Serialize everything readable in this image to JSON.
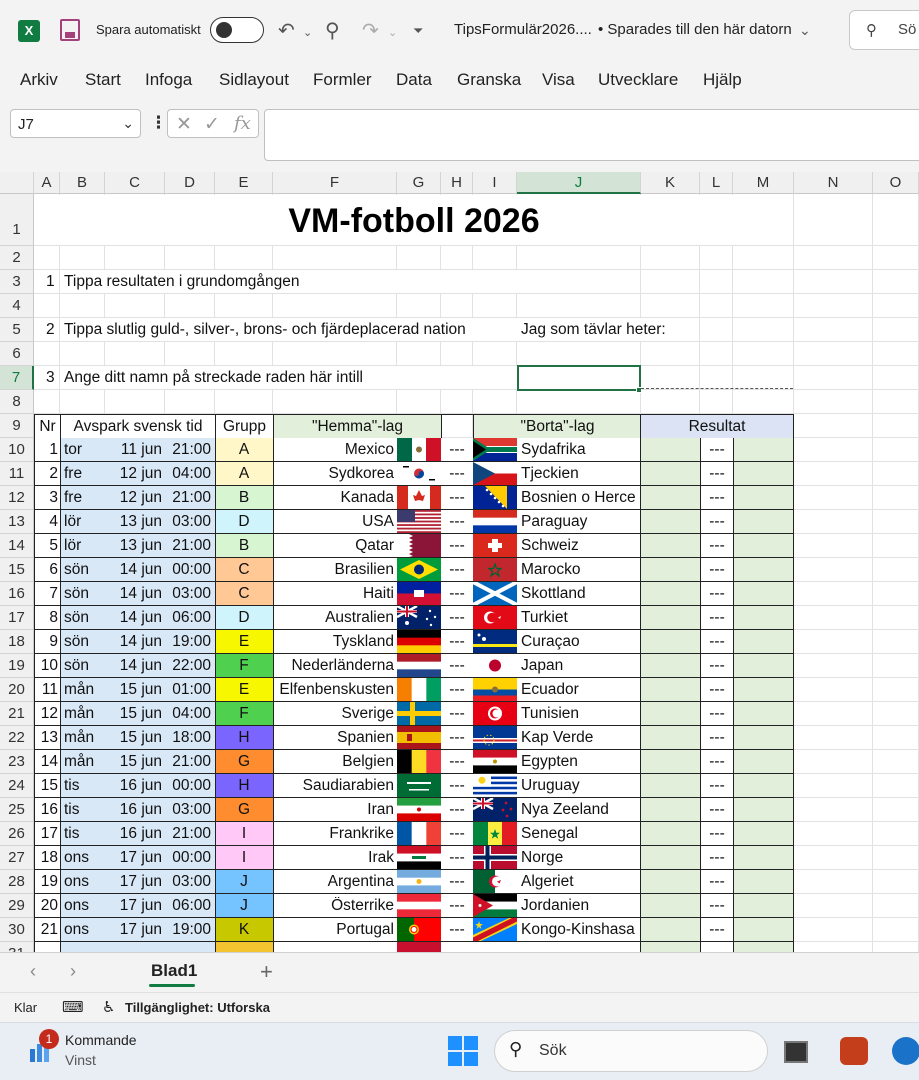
{
  "titlebar": {
    "app_icon_letter": "X",
    "autosave_label": "Spara automatiskt",
    "doc_title": "TipsFormulär2026....",
    "saved_status": "• Sparades till den här datorn",
    "search_placeholder": "Sö"
  },
  "ribbon": {
    "tabs": [
      "Arkiv",
      "Start",
      "Infoga",
      "Sidlayout",
      "Formler",
      "Data",
      "Granska",
      "Visa",
      "Utvecklare",
      "Hjälp"
    ]
  },
  "formula_bar": {
    "name_box": "J7",
    "fx": "fx",
    "value": ""
  },
  "columns": [
    "A",
    "B",
    "C",
    "D",
    "E",
    "F",
    "G",
    "H",
    "I",
    "J",
    "K",
    "L",
    "M",
    "N",
    "O"
  ],
  "selected_cell": "J7",
  "rows": [
    "1",
    "2",
    "3",
    "4",
    "5",
    "6",
    "7",
    "8",
    "9",
    "10",
    "11",
    "12",
    "13",
    "14",
    "15",
    "16",
    "17",
    "18",
    "19",
    "20",
    "21",
    "22",
    "23",
    "24",
    "25",
    "26",
    "27",
    "28",
    "29",
    "30",
    "31"
  ],
  "sheet": {
    "title": "VM-fotboll 2026",
    "instructions": [
      {
        "num": "1",
        "text": "Tippa resultaten i grundomgången"
      },
      {
        "num": "2",
        "text": "Tippa slutlig guld-, silver-, brons- och fjärdeplacerad nation"
      },
      {
        "num": "3",
        "text": "Ange ditt namn på streckade raden här intill"
      }
    ],
    "name_prompt": "Jag som tävlar heter:",
    "headers": {
      "nr": "Nr",
      "kickoff": "Avspark svensk tid",
      "group": "Grupp",
      "home": "\"Hemma\"-lag",
      "away": "\"Borta\"-lag",
      "result": "Resultat"
    },
    "separator": "---",
    "matches": [
      {
        "nr": "1",
        "day": "tor",
        "date": "11 jun",
        "time": "21:00",
        "group": "A",
        "home": "Mexico",
        "away": "Sydafrika"
      },
      {
        "nr": "2",
        "day": "fre",
        "date": "12 jun",
        "time": "04:00",
        "group": "A",
        "home": "Sydkorea",
        "away": "Tjeckien"
      },
      {
        "nr": "3",
        "day": "fre",
        "date": "12 jun",
        "time": "21:00",
        "group": "B",
        "home": "Kanada",
        "away": "Bosnien o Herce"
      },
      {
        "nr": "4",
        "day": "lör",
        "date": "13 jun",
        "time": "03:00",
        "group": "D",
        "home": "USA",
        "away": "Paraguay"
      },
      {
        "nr": "5",
        "day": "lör",
        "date": "13 jun",
        "time": "21:00",
        "group": "B",
        "home": "Qatar",
        "away": "Schweiz"
      },
      {
        "nr": "6",
        "day": "sön",
        "date": "14 jun",
        "time": "00:00",
        "group": "C",
        "home": "Brasilien",
        "away": "Marocko"
      },
      {
        "nr": "7",
        "day": "sön",
        "date": "14 jun",
        "time": "03:00",
        "group": "C",
        "home": "Haiti",
        "away": "Skottland"
      },
      {
        "nr": "8",
        "day": "sön",
        "date": "14 jun",
        "time": "06:00",
        "group": "D",
        "home": "Australien",
        "away": "Turkiet"
      },
      {
        "nr": "9",
        "day": "sön",
        "date": "14 jun",
        "time": "19:00",
        "group": "E",
        "home": "Tyskland",
        "away": "Curaçao"
      },
      {
        "nr": "10",
        "day": "sön",
        "date": "14 jun",
        "time": "22:00",
        "group": "F",
        "home": "Nederländerna",
        "away": "Japan"
      },
      {
        "nr": "11",
        "day": "mån",
        "date": "15 jun",
        "time": "01:00",
        "group": "E",
        "home": "Elfenbenskusten",
        "away": "Ecuador"
      },
      {
        "nr": "12",
        "day": "mån",
        "date": "15 jun",
        "time": "04:00",
        "group": "F",
        "home": "Sverige",
        "away": "Tunisien"
      },
      {
        "nr": "13",
        "day": "mån",
        "date": "15 jun",
        "time": "18:00",
        "group": "H",
        "home": "Spanien",
        "away": "Kap Verde"
      },
      {
        "nr": "14",
        "day": "mån",
        "date": "15 jun",
        "time": "21:00",
        "group": "G",
        "home": "Belgien",
        "away": "Egypten"
      },
      {
        "nr": "15",
        "day": "tis",
        "date": "16 jun",
        "time": "00:00",
        "group": "H",
        "home": "Saudiarabien",
        "away": "Uruguay"
      },
      {
        "nr": "16",
        "day": "tis",
        "date": "16 jun",
        "time": "03:00",
        "group": "G",
        "home": "Iran",
        "away": "Nya Zeeland"
      },
      {
        "nr": "17",
        "day": "tis",
        "date": "16 jun",
        "time": "21:00",
        "group": "I",
        "home": "Frankrike",
        "away": "Senegal"
      },
      {
        "nr": "18",
        "day": "ons",
        "date": "17 jun",
        "time": "00:00",
        "group": "I",
        "home": "Irak",
        "away": "Norge"
      },
      {
        "nr": "19",
        "day": "ons",
        "date": "17 jun",
        "time": "03:00",
        "group": "J",
        "home": "Argentina",
        "away": "Algeriet"
      },
      {
        "nr": "20",
        "day": "ons",
        "date": "17 jun",
        "time": "06:00",
        "group": "J",
        "home": "Österrike",
        "away": "Jordanien"
      },
      {
        "nr": "21",
        "day": "ons",
        "date": "17 jun",
        "time": "19:00",
        "group": "K",
        "home": "Portugal",
        "away": "Kongo-Kinshasa"
      }
    ],
    "group_colors": {
      "A": "#fff7c8",
      "B": "#d6f5d0",
      "C": "#ffc894",
      "D": "#cff4fb",
      "E": "#f7f700",
      "F": "#4fd14f",
      "G": "#ff8c2e",
      "H": "#7a66ff",
      "I": "#ffc8f6",
      "J": "#76c4ff",
      "K": "#c8c800"
    },
    "kickoff_fill": "#d9e8f7",
    "teams_header_fill": "#e2efda",
    "result_header_fill": "#dbe3f4",
    "result_fill": "#e2efda"
  },
  "sheet_tabs": {
    "active": "Blad1",
    "add": "+"
  },
  "statusbar": {
    "ready": "Klar",
    "accessibility": "Tillgänglighet: Utforska"
  },
  "taskbar": {
    "notification_count": "1",
    "widget_title": "Kommande",
    "widget_subtitle": "Vinst",
    "search_label": "Sök"
  }
}
